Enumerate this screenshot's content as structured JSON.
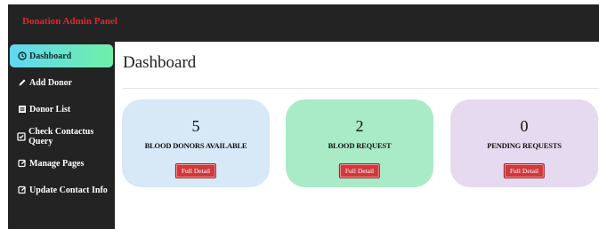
{
  "header": {
    "brand": "Donation Admin Panel"
  },
  "sidebar": {
    "items": [
      {
        "label": "Dashboard",
        "icon": "dashboard-icon",
        "active": true
      },
      {
        "label": "Add Donor",
        "icon": "pencil-icon"
      },
      {
        "label": "Donor List",
        "icon": "list-icon"
      },
      {
        "label": "Check Contactus Query",
        "icon": "check-square-icon"
      },
      {
        "label": "Manage Pages",
        "icon": "edit-square-icon"
      },
      {
        "label": "Update Contact Info",
        "icon": "edit-square-icon"
      }
    ]
  },
  "main": {
    "title": "Dashboard",
    "cards": [
      {
        "count": "5",
        "label": "BLOOD DONORS AVAILABLE",
        "button": "Full Detail",
        "color": "#d7e8f7"
      },
      {
        "count": "2",
        "label": "BLOOD REQUEST",
        "button": "Full Detail",
        "color": "#a9ebc6"
      },
      {
        "count": "0",
        "label": "PENDING REQUESTS",
        "button": "Full Detail",
        "color": "#e5daf0"
      }
    ]
  },
  "colors": {
    "topbar": "#232323",
    "brand": "#e2262a",
    "active_gradient_start": "#62d7f1",
    "active_gradient_end": "#6ff0a8",
    "button": "#d0383b"
  }
}
